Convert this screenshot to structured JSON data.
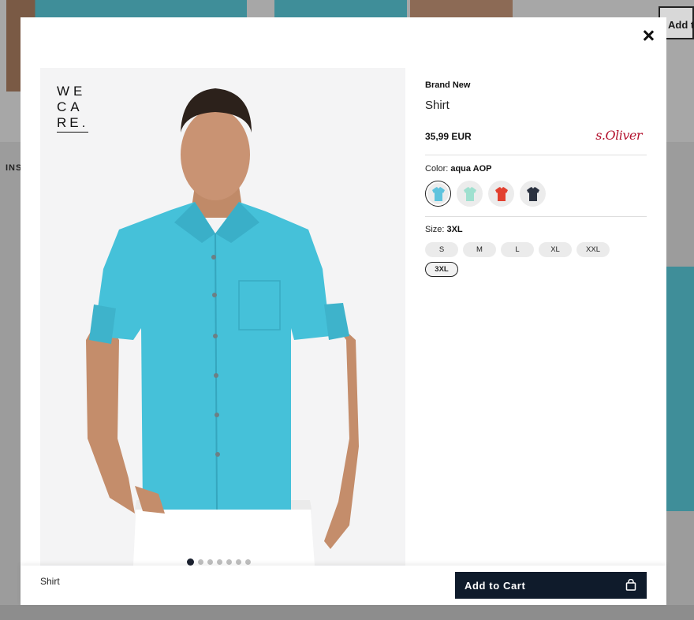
{
  "background": {
    "add_button_label": "Add t",
    "section_label": "INS"
  },
  "modal": {
    "close_icon": "close-icon",
    "image": {
      "badge_lines": [
        "WE",
        "CA",
        "RE."
      ],
      "dot_count": 7,
      "active_dot": 0
    },
    "product": {
      "brand_label": "Brand New",
      "name": "Shirt",
      "price": "35,99 EUR",
      "brand_logo": "s.Oliver",
      "brand_logo_color": "#b3122e"
    },
    "color": {
      "label": "Color:",
      "selected_value": "aqua AOP",
      "options": [
        {
          "name": "aqua AOP",
          "color": "#5ec3dd"
        },
        {
          "name": "mint",
          "color": "#9fe0cf"
        },
        {
          "name": "red",
          "color": "#e2402f"
        },
        {
          "name": "navy",
          "color": "#2b3240"
        }
      ]
    },
    "size": {
      "label": "Size:",
      "selected_value": "3XL",
      "options": [
        "S",
        "M",
        "L",
        "XL",
        "XXL",
        "3XL"
      ]
    },
    "footer": {
      "product_name": "Shirt",
      "add_to_cart_label": "Add to Cart",
      "add_to_cart_icon": "bag-icon",
      "button_color": "#0f1b2b"
    }
  }
}
